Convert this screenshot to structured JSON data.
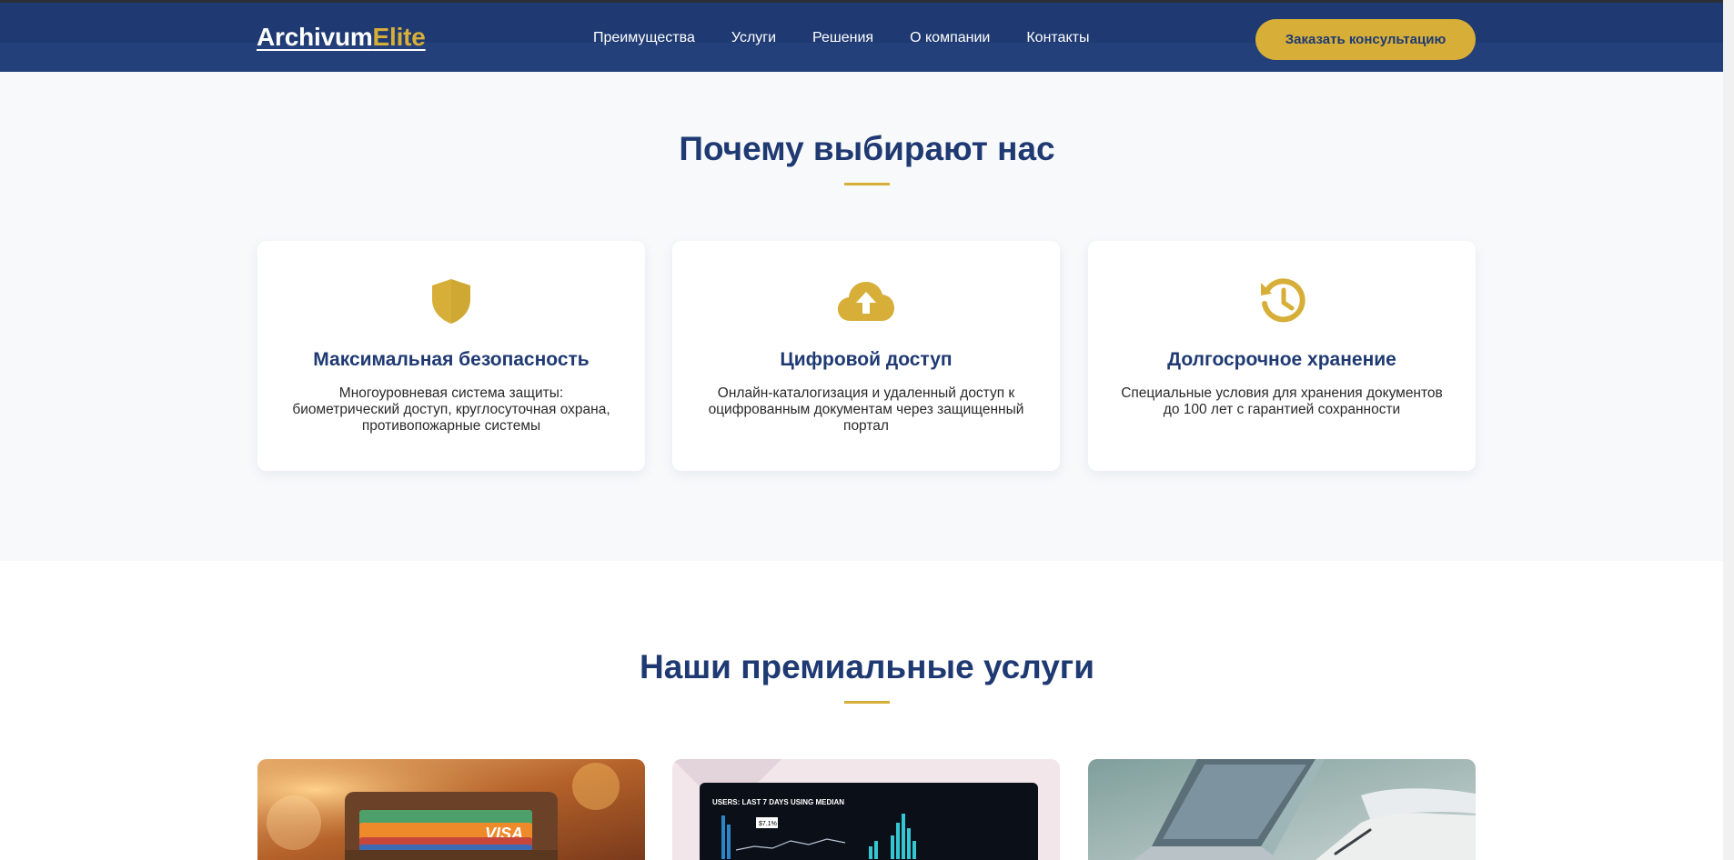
{
  "header": {
    "logo_main": "Archivum",
    "logo_accent": "Elite",
    "nav": [
      {
        "label": "Преимущества"
      },
      {
        "label": "Услуги"
      },
      {
        "label": "Решения"
      },
      {
        "label": "О компании"
      },
      {
        "label": "Контакты"
      }
    ],
    "cta_label": "Заказать консультацию"
  },
  "why": {
    "title": "Почему выбирают нас",
    "cards": [
      {
        "icon": "shield-icon",
        "title": "Максимальная безопасность",
        "text": "Многоуровневая система защиты: биометрический доступ, круглосуточная охрана, противопожарные системы"
      },
      {
        "icon": "cloud-upload-icon",
        "title": "Цифровой доступ",
        "text": "Онлайн-каталогизация и удаленный доступ к оцифрованным документам через защищенный портал"
      },
      {
        "icon": "history-icon",
        "title": "Долгосрочное хранение",
        "text": "Специальные условия для хранения документов до 100 лет с гарантией сохранности"
      }
    ]
  },
  "services": {
    "title": "Наши премиальные услуги",
    "images": [
      {
        "name": "wallet-cards-image",
        "card_text": "VISA"
      },
      {
        "name": "analytics-dashboard-image",
        "screen_header": "USERS: LAST 7 DAYS USING MEDIAN",
        "screen_value": "$7.1%"
      },
      {
        "name": "laptop-work-image"
      }
    ]
  },
  "colors": {
    "primary": "#1f3a72",
    "accent": "#d6ae38",
    "section_bg": "#f7f9fb"
  }
}
